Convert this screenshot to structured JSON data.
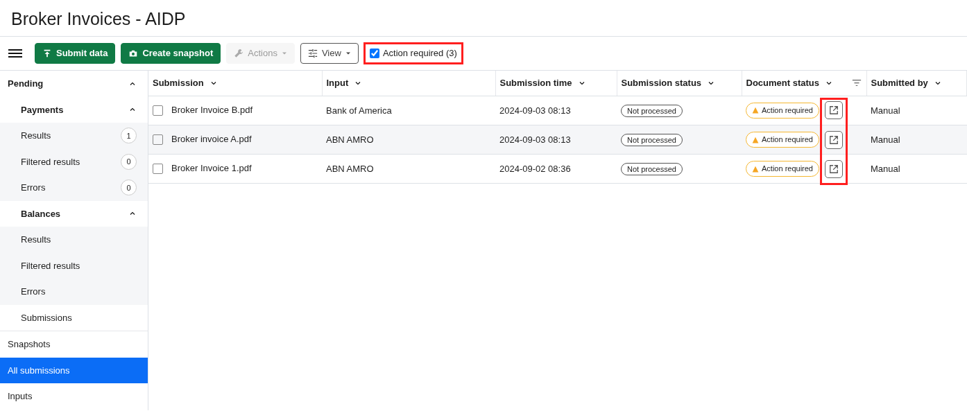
{
  "title": "Broker Invoices - AIDP",
  "toolbar": {
    "buttons": [
      {
        "label": "Submit data",
        "kind": "upload",
        "disabled": false
      },
      {
        "label": "Create snapshot",
        "kind": "camera",
        "disabled": false
      },
      {
        "label": "Actions",
        "kind": "actions",
        "disabled": true
      },
      {
        "label": "View",
        "kind": "view",
        "disabled": false
      }
    ],
    "filter": {
      "label": "Action required (3)",
      "checked": true,
      "highlighted": true
    }
  },
  "sidebar": {
    "items": [
      {
        "label": "Pending",
        "expanded": true,
        "selected": false,
        "children": [
          {
            "label": "Payments",
            "expanded": true,
            "selected": false,
            "children": [
              {
                "label": "Results",
                "count": "1",
                "selected": false
              },
              {
                "label": "Filtered results",
                "count": "0",
                "selected": false
              },
              {
                "label": "Errors",
                "count": "0",
                "selected": false
              }
            ]
          },
          {
            "label": "Balances",
            "expanded": true,
            "selected": false,
            "children": [
              {
                "label": "Results",
                "selected": false
              },
              {
                "label": "Filtered results",
                "selected": false
              },
              {
                "label": "Errors",
                "selected": false
              }
            ]
          },
          {
            "label": "Submissions",
            "selected": false
          }
        ]
      },
      {
        "label": "Snapshots",
        "selected": false
      },
      {
        "label": "All submissions",
        "selected": true
      },
      {
        "label": "Inputs",
        "selected": false
      }
    ]
  },
  "table": {
    "columns": [
      {
        "label": "Submission",
        "filter": false
      },
      {
        "label": "Input",
        "filter": false
      },
      {
        "label": "Submission time",
        "filter": false
      },
      {
        "label": "Submission status",
        "filter": false
      },
      {
        "label": "Document status",
        "filter": true
      },
      {
        "label": "Submitted by",
        "filter": false
      }
    ],
    "open_buttons_highlighted": true,
    "rows": [
      {
        "checked": false,
        "submission": "Broker Invoice B.pdf",
        "input": "Bank of America",
        "time": "2024-09-03 08:13",
        "submission_status": "Not processed",
        "document_status": "Action required",
        "submitted_by": "Manual"
      },
      {
        "checked": false,
        "submission": "Broker invoice A.pdf",
        "input": "ABN AMRO",
        "time": "2024-09-03 08:13",
        "submission_status": "Not processed",
        "document_status": "Action required",
        "submitted_by": "Manual"
      },
      {
        "checked": false,
        "submission": "Broker Invoice 1.pdf",
        "input": "ABN AMRO",
        "time": "2024-09-02 08:36",
        "submission_status": "Not processed",
        "document_status": "Action required",
        "submitted_by": "Manual"
      }
    ]
  }
}
